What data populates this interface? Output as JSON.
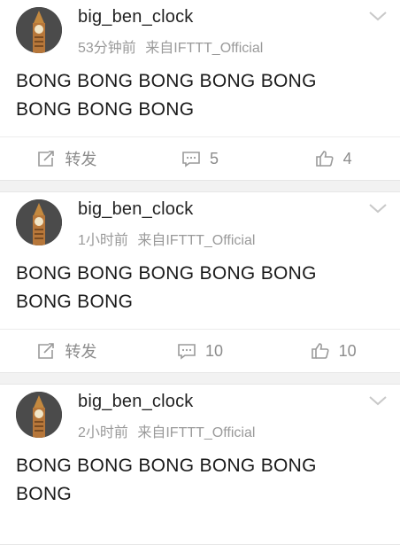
{
  "posts": [
    {
      "username": "big_ben_clock",
      "time": "53分钟前",
      "source": "来自IFTTT_Official",
      "text_line1": "BONG BONG BONG BONG BONG",
      "text_line2": "BONG BONG BONG",
      "repost_label": "转发",
      "comments": "5",
      "likes": "4"
    },
    {
      "username": "big_ben_clock",
      "time": "1小时前",
      "source": "来自IFTTT_Official",
      "text_line1": "BONG BONG BONG BONG BONG",
      "text_line2": "BONG BONG",
      "repost_label": "转发",
      "comments": "10",
      "likes": "10"
    },
    {
      "username": "big_ben_clock",
      "time": "2小时前",
      "source": "来自IFTTT_Official",
      "text_line1": "BONG BONG BONG BONG BONG",
      "text_line2": "BONG"
    }
  ],
  "icons": {
    "repost": "edit-share-icon",
    "comment": "comment-icon",
    "like": "thumbs-up-icon",
    "more": "chevron-down-icon"
  },
  "colors": {
    "meta_text": "#9a9a9a",
    "action_text": "#8c8c8c",
    "background": "#f2f2f2"
  }
}
